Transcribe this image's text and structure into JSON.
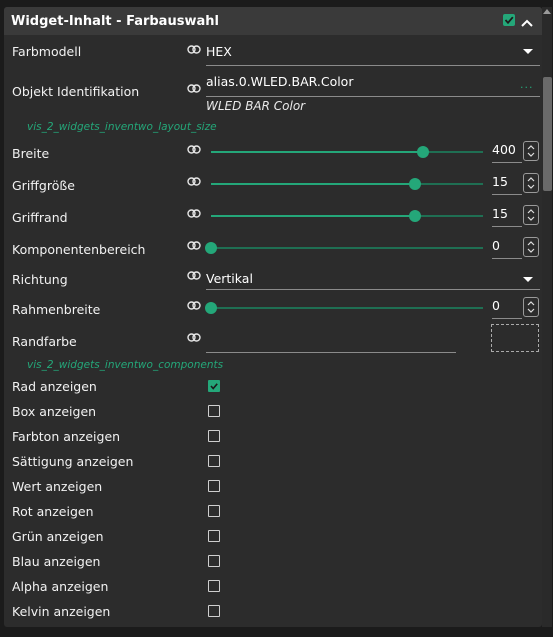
{
  "header": {
    "title": "Widget-Inhalt - Farbauswahl",
    "enabled": true
  },
  "colors": {
    "accent": "#24a779",
    "panel": "#2c2c2c",
    "header": "#3a3a3a"
  },
  "fields": {
    "farbmodell": {
      "label": "Farbmodell",
      "value": "HEX"
    },
    "objekt": {
      "label": "Objekt Identifikation",
      "value": "alias.0.WLED.BAR.Color",
      "sub": "WLED BAR Color",
      "more": "..."
    },
    "group_layout": "vis_2_widgets_inventwo_layout_size",
    "breite": {
      "label": "Breite",
      "value": "400",
      "fraction": 0.78
    },
    "griffgroesse": {
      "label": "Griffgröße",
      "value": "15",
      "fraction": 0.75
    },
    "griffrand": {
      "label": "Griffrand",
      "value": "15",
      "fraction": 0.75
    },
    "komponentenbereich": {
      "label": "Komponentenbereich",
      "value": "0",
      "fraction": 0
    },
    "richtung": {
      "label": "Richtung",
      "value": "Vertikal"
    },
    "rahmenbreite": {
      "label": "Rahmenbreite",
      "value": "0",
      "fraction": 0
    },
    "randfarbe": {
      "label": "Randfarbe",
      "value": ""
    },
    "group_components": "vis_2_widgets_inventwo_components"
  },
  "checkboxes": [
    {
      "label": "Rad anzeigen",
      "checked": true
    },
    {
      "label": "Box anzeigen",
      "checked": false
    },
    {
      "label": "Farbton anzeigen",
      "checked": false
    },
    {
      "label": "Sättigung anzeigen",
      "checked": false
    },
    {
      "label": "Wert anzeigen",
      "checked": false
    },
    {
      "label": "Rot anzeigen",
      "checked": false
    },
    {
      "label": "Grün anzeigen",
      "checked": false
    },
    {
      "label": "Blau anzeigen",
      "checked": false
    },
    {
      "label": "Alpha anzeigen",
      "checked": false
    },
    {
      "label": "Kelvin anzeigen",
      "checked": false
    }
  ],
  "icons": {
    "link": "link-icon",
    "collapse": "chevron-up-icon",
    "dropdown": "caret-down-icon"
  }
}
